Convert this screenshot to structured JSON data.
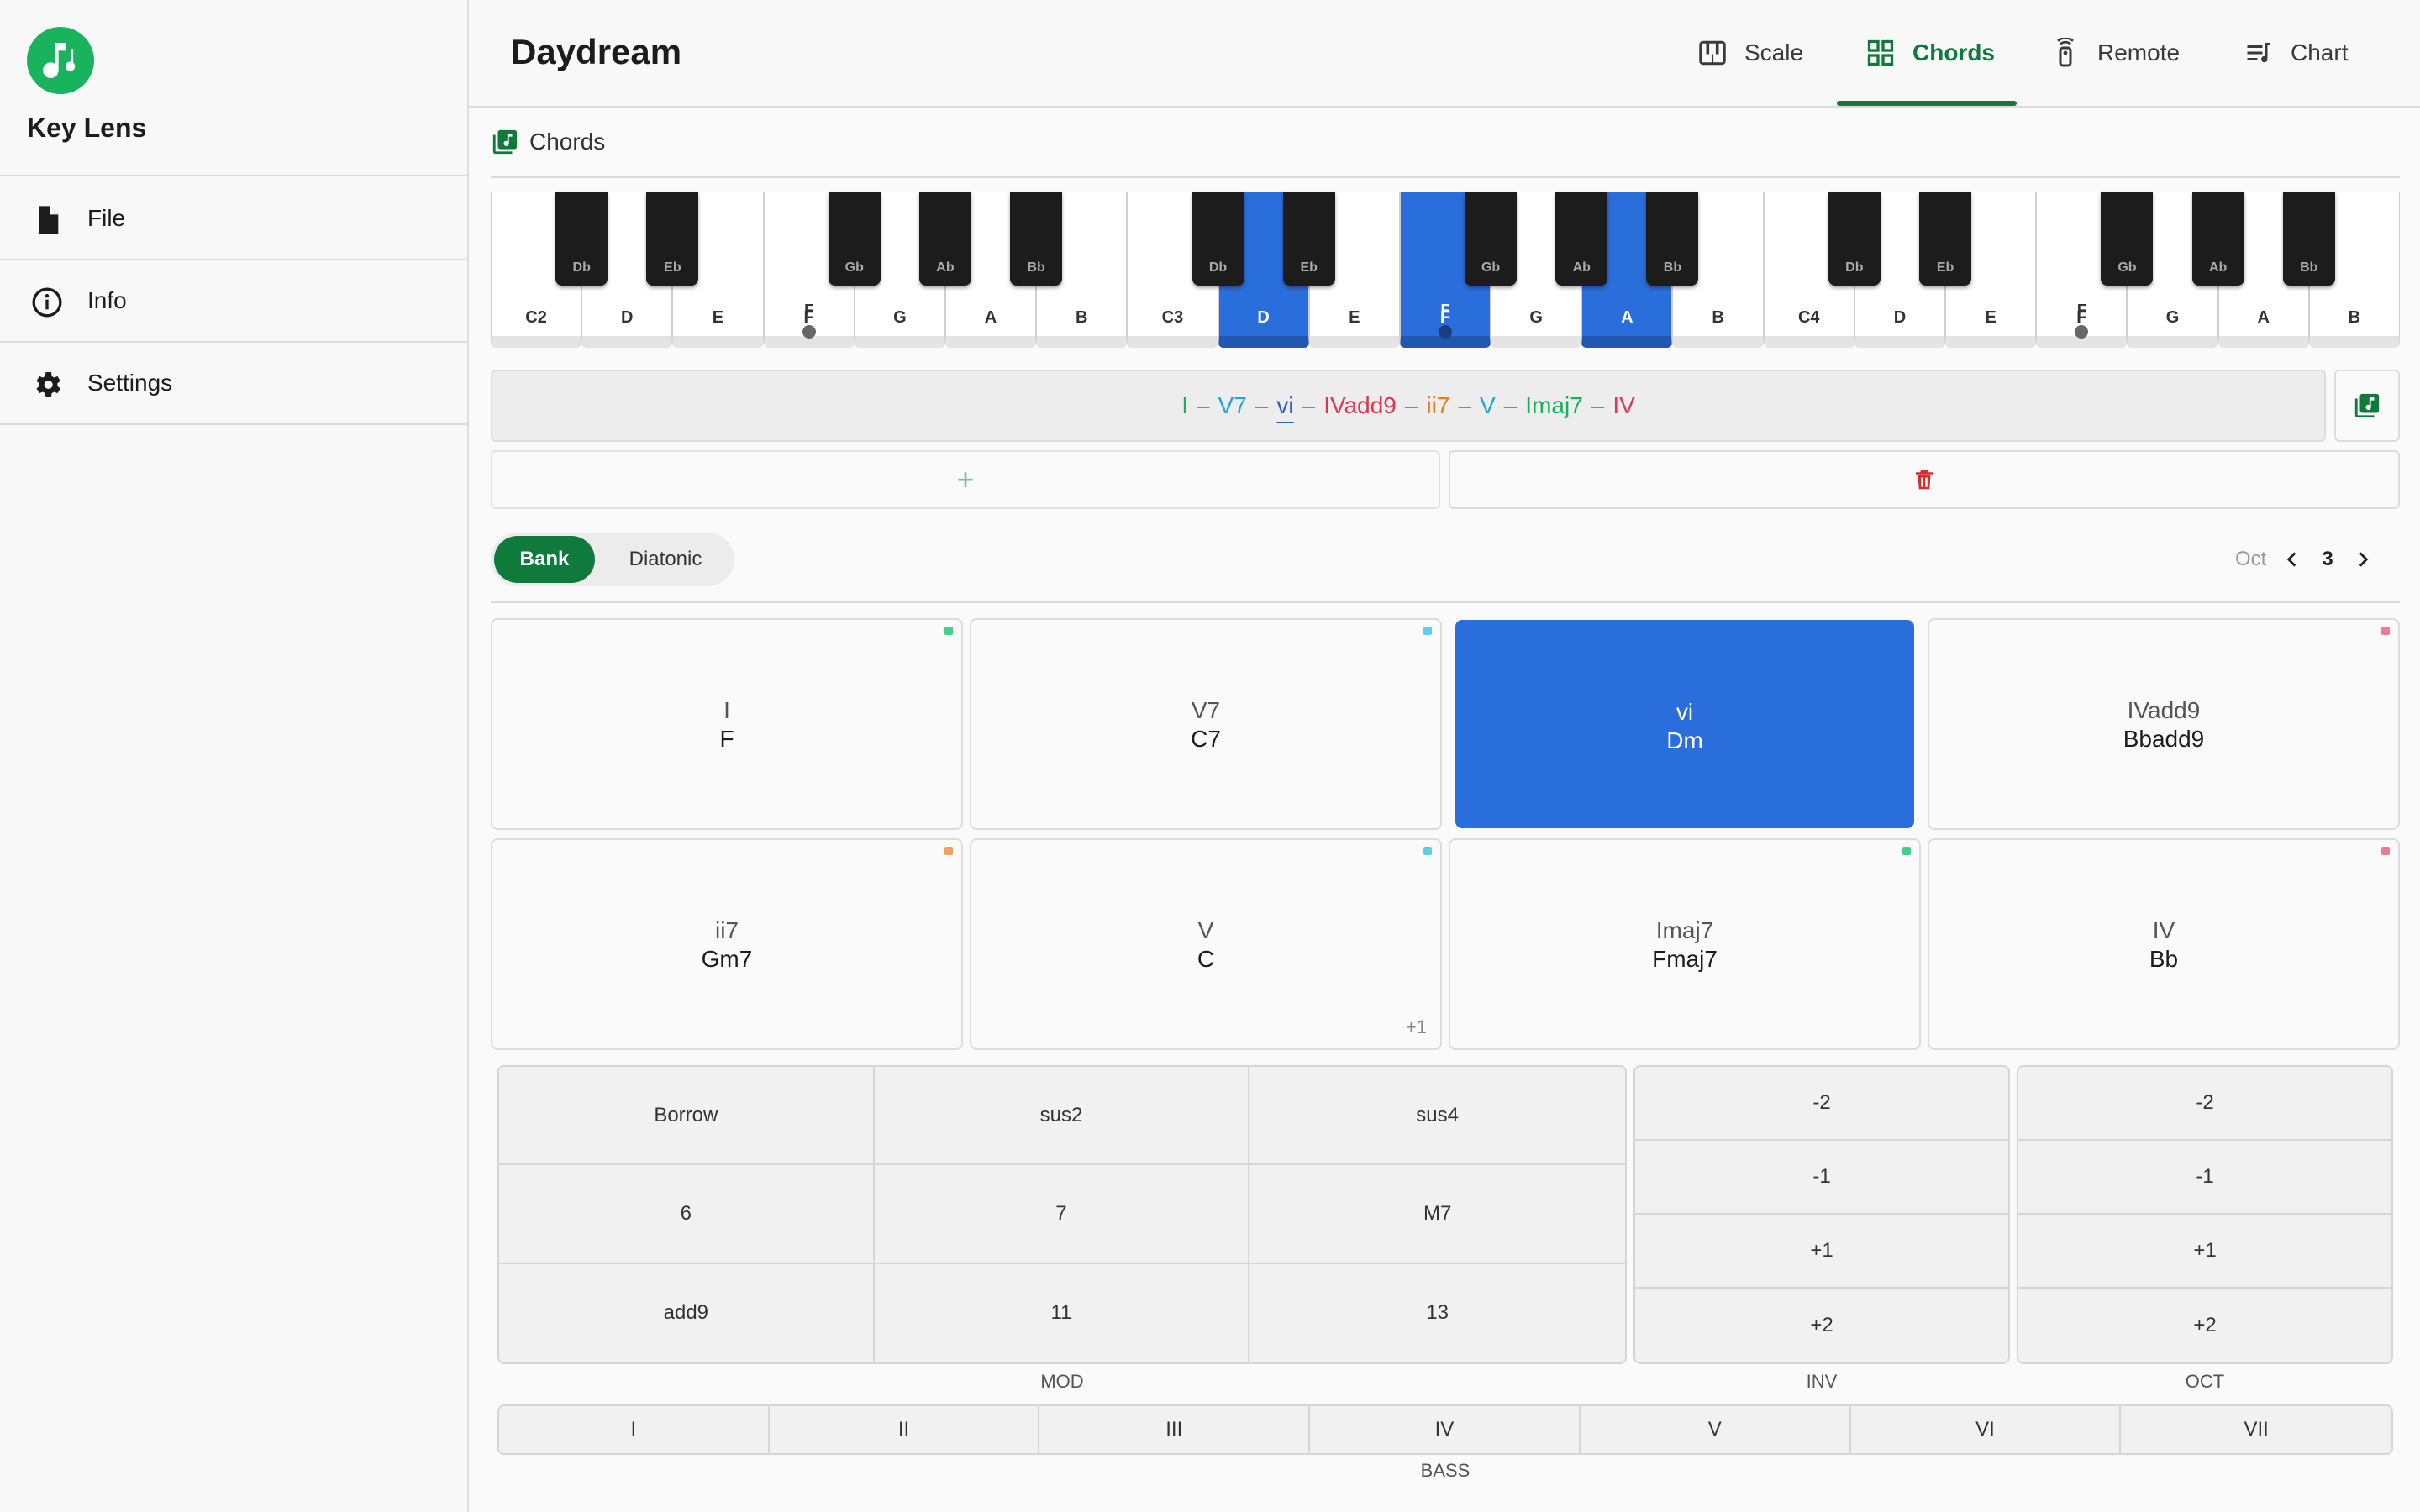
{
  "app": {
    "name": "Key Lens"
  },
  "sidebar": {
    "items": [
      {
        "label": "File",
        "icon": "file-icon"
      },
      {
        "label": "Info",
        "icon": "info-icon"
      },
      {
        "label": "Settings",
        "icon": "gear-icon"
      }
    ]
  },
  "header": {
    "title": "Daydream",
    "tabs": [
      {
        "label": "Scale",
        "icon": "piano-icon",
        "active": false
      },
      {
        "label": "Chords",
        "icon": "grid-icon",
        "active": true
      },
      {
        "label": "Remote",
        "icon": "remote-icon",
        "active": false
      },
      {
        "label": "Chart",
        "icon": "chart-list-icon",
        "active": false
      }
    ]
  },
  "section": {
    "title": "Chords",
    "icon": "music-library-icon"
  },
  "piano": {
    "white_keys": [
      "C2",
      "D",
      "E",
      "F",
      "G",
      "A",
      "B",
      "C3",
      "D",
      "E",
      "F",
      "G",
      "A",
      "B",
      "C4",
      "D",
      "E",
      "F",
      "G",
      "A",
      "B"
    ],
    "black_keys": [
      "Db",
      "Eb",
      "Gb",
      "Ab",
      "Bb",
      "Db",
      "Eb",
      "Gb",
      "Ab",
      "Bb",
      "Db",
      "Eb",
      "Gb",
      "Ab",
      "Bb"
    ],
    "lit_white_keys": [
      "D",
      "F",
      "A"
    ],
    "dotted_keys": [
      "F",
      "F",
      "F"
    ]
  },
  "progression": {
    "chords": [
      {
        "label": "I",
        "color": "#1aae5a",
        "current": false
      },
      {
        "label": "V7",
        "color": "#1aa9d6",
        "current": false
      },
      {
        "label": "vi",
        "color": "#2a5fc7",
        "current": true
      },
      {
        "label": "IVadd9",
        "color": "#e0344f",
        "current": false
      },
      {
        "label": "ii7",
        "color": "#ec7a1c",
        "current": false
      },
      {
        "label": "V",
        "color": "#1aa9d6",
        "current": false
      },
      {
        "label": "Imaj7",
        "color": "#1aae5a",
        "current": false
      },
      {
        "label": "IV",
        "color": "#e0344f",
        "current": false
      }
    ],
    "separator": "–",
    "add_label": "+",
    "delete_icon": "trash-icon",
    "library_icon": "music-library-icon"
  },
  "toggle": {
    "options": [
      "Bank",
      "Diatonic"
    ],
    "selected": "Bank"
  },
  "octave": {
    "label": "Oct",
    "value": "3"
  },
  "cards": [
    {
      "numeral": "I",
      "name": "F",
      "corner": "#3fd28f",
      "selected": false,
      "extra": ""
    },
    {
      "numeral": "V7",
      "name": "C7",
      "corner": "#5ad0ea",
      "selected": false,
      "extra": ""
    },
    {
      "numeral": "vi",
      "name": "Dm",
      "corner": "",
      "selected": true,
      "extra": ""
    },
    {
      "numeral": "IVadd9",
      "name": "Bbadd9",
      "corner": "#f07a90",
      "selected": false,
      "extra": ""
    },
    {
      "numeral": "ii7",
      "name": "Gm7",
      "corner": "#f3a15a",
      "selected": false,
      "extra": ""
    },
    {
      "numeral": "V",
      "name": "C",
      "corner": "#5ad0ea",
      "selected": false,
      "extra": "+1"
    },
    {
      "numeral": "Imaj7",
      "name": "Fmaj7",
      "corner": "#3fd28f",
      "selected": false,
      "extra": ""
    },
    {
      "numeral": "IV",
      "name": "Bb",
      "corner": "#f07a90",
      "selected": false,
      "extra": ""
    }
  ],
  "mod": {
    "label": "MOD",
    "rows": [
      [
        "Borrow",
        "sus2",
        "sus4"
      ],
      [
        "6",
        "7",
        "M7"
      ],
      [
        "add9",
        "11",
        "13"
      ]
    ]
  },
  "inv": {
    "label": "INV",
    "values": [
      "-2",
      "-1",
      "+1",
      "+2"
    ]
  },
  "oct": {
    "label": "OCT",
    "values": [
      "-2",
      "-1",
      "+1",
      "+2"
    ]
  },
  "bass": {
    "label": "BASS",
    "values": [
      "I",
      "II",
      "III",
      "IV",
      "V",
      "VI",
      "VII"
    ]
  }
}
